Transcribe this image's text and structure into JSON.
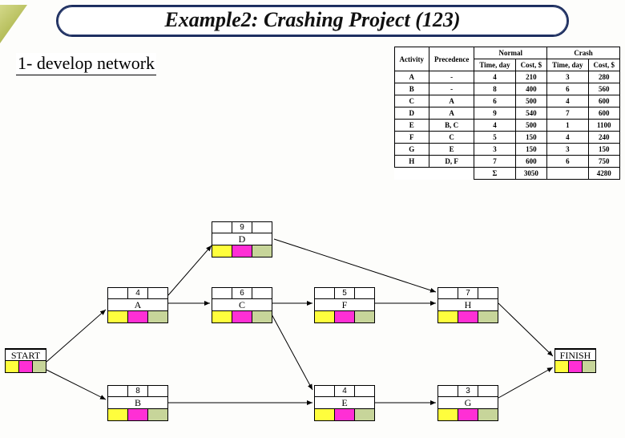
{
  "title": "Example2: Crashing Project (123)",
  "subtitle": "1- develop network",
  "table": {
    "head_activity": "Activity",
    "head_precedence": "Precedence",
    "head_normal": "Normal",
    "head_crash": "Crash",
    "head_time": "Time, day",
    "head_cost": "Cost, $",
    "rows": [
      {
        "act": "A",
        "pre": "-",
        "nt": "4",
        "nc": "210",
        "ct": "3",
        "cc": "280"
      },
      {
        "act": "B",
        "pre": "-",
        "nt": "8",
        "nc": "400",
        "ct": "6",
        "cc": "560"
      },
      {
        "act": "C",
        "pre": "A",
        "nt": "6",
        "nc": "500",
        "ct": "4",
        "cc": "600"
      },
      {
        "act": "D",
        "pre": "A",
        "nt": "9",
        "nc": "540",
        "ct": "7",
        "cc": "600"
      },
      {
        "act": "E",
        "pre": "B, C",
        "nt": "4",
        "nc": "500",
        "ct": "1",
        "cc": "1100"
      },
      {
        "act": "F",
        "pre": "C",
        "nt": "5",
        "nc": "150",
        "ct": "4",
        "cc": "240"
      },
      {
        "act": "G",
        "pre": "E",
        "nt": "3",
        "nc": "150",
        "ct": "3",
        "cc": "150"
      },
      {
        "act": "H",
        "pre": "D, F",
        "nt": "7",
        "nc": "600",
        "ct": "6",
        "cc": "750"
      }
    ],
    "sum_label": "Σ",
    "sum_nc": "3050",
    "sum_cc": "4280"
  },
  "nodes": {
    "start": "START",
    "finish": "FINISH",
    "A": {
      "dur": "4",
      "name": "A"
    },
    "B": {
      "dur": "8",
      "name": "B"
    },
    "C": {
      "dur": "6",
      "name": "C"
    },
    "D": {
      "dur": "9",
      "name": "D"
    },
    "E": {
      "dur": "4",
      "name": "E"
    },
    "F": {
      "dur": "5",
      "name": "F"
    },
    "G": {
      "dur": "3",
      "name": "G"
    },
    "H": {
      "dur": "7",
      "name": "H"
    }
  }
}
